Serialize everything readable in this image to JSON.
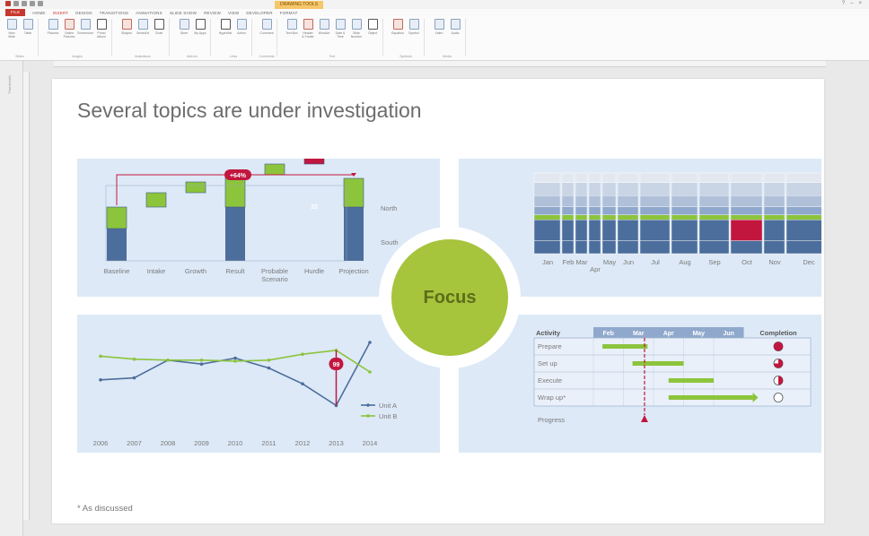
{
  "app": {
    "context_tab": "DRAWING TOOLS",
    "tabs": [
      "FILE",
      "HOME",
      "INSERT",
      "DESIGN",
      "TRANSITIONS",
      "ANIMATIONS",
      "SLIDE SHOW",
      "REVIEW",
      "VIEW",
      "DEVELOPER",
      "FORMAT"
    ],
    "active_tab": "INSERT",
    "thumbnails_label": "Thumbnails",
    "window_controls": [
      "?",
      "–",
      "×"
    ]
  },
  "ribbon": {
    "groups": [
      {
        "label": "Slides",
        "buttons": [
          "New Slide",
          "Table"
        ]
      },
      {
        "label": "Images",
        "buttons": [
          "Pictures",
          "Online Pictures",
          "Screenshot",
          "Photo Album"
        ]
      },
      {
        "label": "Illustrations",
        "buttons": [
          "Shapes",
          "SmartArt",
          "Chart"
        ]
      },
      {
        "label": "Add-ins",
        "buttons": [
          "Store",
          "My Apps"
        ]
      },
      {
        "label": "Links",
        "buttons": [
          "Hyperlink",
          "Action"
        ]
      },
      {
        "label": "Comments",
        "buttons": [
          "Comment"
        ]
      },
      {
        "label": "Text",
        "buttons": [
          "Text Box",
          "Header & Footer",
          "WordArt",
          "Date & Time",
          "Slide Number",
          "Object"
        ]
      },
      {
        "label": "Symbols",
        "buttons": [
          "Equation",
          "Symbol"
        ]
      },
      {
        "label": "Media",
        "buttons": [
          "Video",
          "Audio"
        ]
      }
    ]
  },
  "slide": {
    "title": "Several topics are under investigation",
    "center_label": "Focus",
    "footnote": "*  As discussed"
  },
  "colors": {
    "blue": "#4c6e9c",
    "light_blue": "#8fa8cc",
    "green": "#8cc43c",
    "crimson": "#c2163f",
    "panel_bg": "#dde9f7",
    "focus_green": "#a6c43c"
  },
  "chart_data": [
    {
      "type": "bar",
      "subtype": "waterfall-stacked",
      "categories": [
        "Baseline",
        "Intake",
        "Growth",
        "Result",
        "Probable Scenario",
        "Hurdle",
        "Projection"
      ],
      "series": [
        {
          "name": "South",
          "values": [
            18,
            0,
            0,
            30,
            0,
            0,
            30
          ]
        },
        {
          "name": "North",
          "values": [
            12,
            8,
            6,
            18,
            6,
            14,
            16
          ]
        }
      ],
      "annotations": [
        {
          "label": "+64%",
          "from": "Baseline",
          "to": "Projection"
        },
        {
          "label": "33",
          "at": "Hurdle"
        }
      ],
      "segment_labels": [
        "North",
        "South"
      ]
    },
    {
      "type": "bar",
      "subtype": "stacked-mekko",
      "categories": [
        "Jan",
        "Feb",
        "Mar",
        "Apr",
        "May",
        "Jun",
        "Jul",
        "Aug",
        "Sep",
        "Oct",
        "Nov",
        "Dec"
      ],
      "highlight": "Oct"
    },
    {
      "type": "line",
      "x": [
        2006,
        2007,
        2008,
        2009,
        2010,
        2011,
        2012,
        2013,
        2014
      ],
      "series": [
        {
          "name": "Unit A",
          "values": [
            52,
            54,
            72,
            68,
            74,
            64,
            48,
            26,
            90
          ]
        },
        {
          "name": "Unit B",
          "values": [
            76,
            73,
            72,
            72,
            71,
            72,
            78,
            82,
            60
          ]
        }
      ],
      "annotations": [
        {
          "label": "99",
          "at": 2013
        }
      ]
    },
    {
      "type": "table",
      "subtype": "gantt",
      "headers": [
        "Activity",
        "Feb",
        "Mar",
        "Apr",
        "May",
        "Jun",
        "Completion"
      ],
      "rows": [
        {
          "activity": "Prepare",
          "start": 0.3,
          "end": 1.8,
          "completion": 1.0
        },
        {
          "activity": "Set up",
          "start": 1.3,
          "end": 3.0,
          "completion": 0.75
        },
        {
          "activity": "Execute",
          "start": 2.5,
          "end": 4.0,
          "completion": 0.5
        },
        {
          "activity": "Wrap up*",
          "start": 2.5,
          "end": 5.3,
          "completion": 0.0
        }
      ],
      "progress_label": "Progress",
      "progress_at": 1.7
    }
  ]
}
